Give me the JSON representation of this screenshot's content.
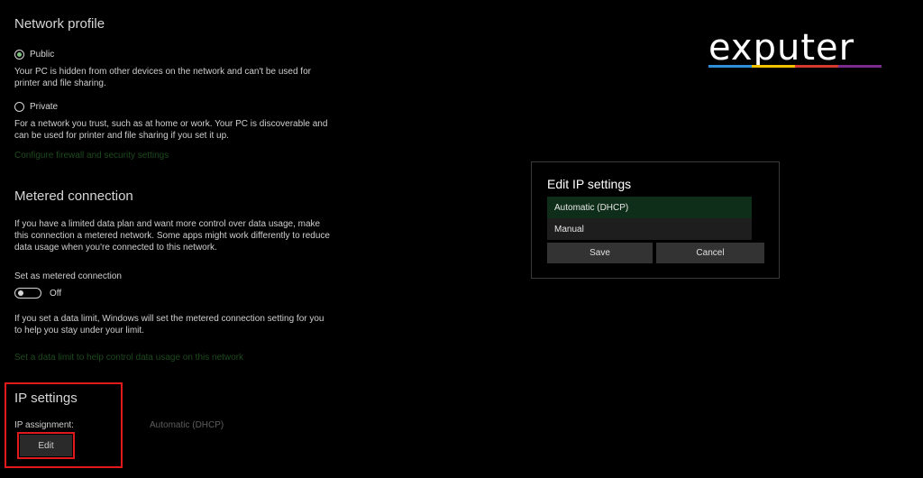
{
  "network_profile": {
    "heading": "Network profile",
    "public": {
      "label": "Public",
      "description": "Your PC is hidden from other devices on the network and can't be used for printer and file sharing.",
      "selected": true
    },
    "private": {
      "label": "Private",
      "description": "For a network you trust, such as at home or work. Your PC is discoverable and can be used for printer and file sharing if you set it up.",
      "selected": false
    },
    "firewall_link": "Configure firewall and security settings"
  },
  "metered": {
    "heading": "Metered connection",
    "description": "If you have a limited data plan and want more control over data usage, make this connection a metered network. Some apps might work differently to reduce data usage when you're connected to this network.",
    "toggle_label": "Set as metered connection",
    "toggle_state": "Off",
    "limit_note": "If you set a data limit, Windows will set the metered connection setting for you to help you stay under your limit.",
    "limit_link": "Set a data limit to help control data usage on this network"
  },
  "ip_settings": {
    "heading": "IP settings",
    "assignment_label": "IP assignment:",
    "assignment_value": "Automatic (DHCP)",
    "edit_label": "Edit"
  },
  "dialog": {
    "title": "Edit IP settings",
    "options": [
      "Automatic (DHCP)",
      "Manual"
    ],
    "selected_option": "Automatic (DHCP)",
    "save_label": "Save",
    "cancel_label": "Cancel"
  },
  "logo": {
    "text": "exputer",
    "stripe_colors": [
      "#2f8fd8",
      "#f2c200",
      "#d63a2f",
      "#7a2b8c"
    ]
  },
  "colors": {
    "highlight": "#e0191d",
    "link": "#1d4a1d",
    "selected_option": "#0f2e19"
  }
}
